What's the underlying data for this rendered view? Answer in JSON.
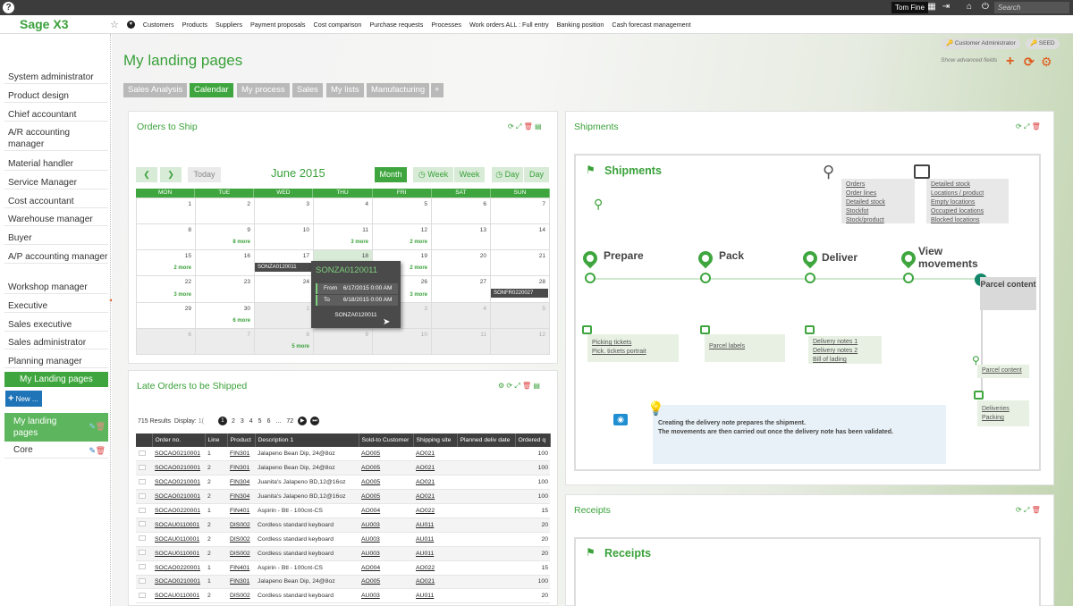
{
  "topbar": {
    "help": "?",
    "user": "Tom Fine",
    "search_placeholder": "Search"
  },
  "brand": "Sage X3",
  "menu": [
    "Customers",
    "Products",
    "Suppliers",
    "Payment proposals",
    "Cost comparison",
    "Purchase requests",
    "Processes",
    "Work orders ALL : Full entry",
    "Banking position",
    "Cash forecast management"
  ],
  "sidebar": {
    "items": [
      "System administrator",
      "Product design",
      "Chief accountant",
      "A/R accounting manager",
      "Material handler",
      "Service Manager",
      "Cost accountant",
      "Warehouse manager",
      "Buyer",
      "A/P accounting manager",
      "Workshop manager",
      "Executive",
      "Sales executive",
      "Sales administrator",
      "Planning manager"
    ],
    "section": "My Landing pages",
    "new_button": "New ...",
    "pages": [
      "My landing pages",
      "Core"
    ]
  },
  "header": {
    "title": "My landing pages",
    "role": "Customer Administrator",
    "seed": "SEED",
    "advanced": "Show advanced fields"
  },
  "tabs": [
    "Sales Analysis",
    "Calendar",
    "My process",
    "Sales",
    "My lists",
    "Manufacturing",
    "+"
  ],
  "orders_to_ship": {
    "title": "Orders to Ship",
    "nav": {
      "today": "Today",
      "month_title": "June 2015",
      "month": "Month",
      "week1": "Week",
      "week2": "Week",
      "day1": "Day",
      "day2": "Day"
    },
    "weekdays": [
      "MON",
      "TUE",
      "WED",
      "THU",
      "FRI",
      "SAT",
      "SUN"
    ],
    "weeks": [
      [
        {
          "d": "1"
        },
        {
          "d": "2"
        },
        {
          "d": "3"
        },
        {
          "d": "4"
        },
        {
          "d": "5"
        },
        {
          "d": "6"
        },
        {
          "d": "7"
        }
      ],
      [
        {
          "d": "8"
        },
        {
          "d": "9",
          "more": "8 more"
        },
        {
          "d": "10"
        },
        {
          "d": "11",
          "more": "3 more"
        },
        {
          "d": "12",
          "more": "2 more"
        },
        {
          "d": "13"
        },
        {
          "d": "14"
        }
      ],
      [
        {
          "d": "15",
          "more": "2 more"
        },
        {
          "d": "16"
        },
        {
          "d": "17",
          "ev": "SONZA0120011"
        },
        {
          "d": "18",
          "today": true
        },
        {
          "d": "19",
          "more": "2 more"
        },
        {
          "d": "20"
        },
        {
          "d": "21"
        }
      ],
      [
        {
          "d": "22",
          "more": "3 more"
        },
        {
          "d": "23"
        },
        {
          "d": "24"
        },
        {
          "d": "25"
        },
        {
          "d": "26",
          "more": "3 more"
        },
        {
          "d": "27"
        },
        {
          "d": "28",
          "ev": "SONFR0220027"
        }
      ],
      [
        {
          "d": "29"
        },
        {
          "d": "30",
          "more": "6 more"
        },
        {
          "d": "1",
          "grey": true
        },
        {
          "d": "2",
          "grey": true
        },
        {
          "d": "3",
          "grey": true
        },
        {
          "d": "4",
          "grey": true
        },
        {
          "d": "5",
          "grey": true
        }
      ],
      [
        {
          "d": "6",
          "grey": true
        },
        {
          "d": "7",
          "grey": true
        },
        {
          "d": "8",
          "grey": true,
          "more": "5 more"
        },
        {
          "d": "9",
          "grey": true
        },
        {
          "d": "10",
          "grey": true
        },
        {
          "d": "11",
          "grey": true
        },
        {
          "d": "12",
          "grey": true
        }
      ]
    ],
    "popup": {
      "title": "SONZA0120011",
      "from_label": "From",
      "from": "6/17/2015 0:00 AM",
      "to_label": "To",
      "to": "6/18/2015 0:00 AM",
      "id": "SONZA0120011"
    }
  },
  "late_orders": {
    "title": "Late Orders to be Shipped",
    "results": "715 Results",
    "display_label": "Display:",
    "display_value": "1(",
    "pages": [
      "1",
      "2",
      "3",
      "4",
      "5",
      "6",
      "...",
      "72"
    ],
    "columns": [
      "",
      "Order no.",
      "Line",
      "Product",
      "Description 1",
      "Sold-to Customer",
      "Shipping site",
      "Planned deliv date",
      "Ordered q"
    ],
    "rows": [
      [
        "SOCAO0210001",
        "1",
        "FIN301",
        "Jalapeno Bean Dip, 24@8oz",
        "AO005",
        "AO021",
        "",
        "100"
      ],
      [
        "SOCAO0210001",
        "2",
        "FIN301",
        "Jalapeno Bean Dip, 24@8oz",
        "AO005",
        "AO021",
        "",
        "100"
      ],
      [
        "SOCAO0210001",
        "2",
        "FIN304",
        "Juanita's Jalapeno BD,12@16oz",
        "AO005",
        "AO021",
        "",
        "100"
      ],
      [
        "SOCAO0210001",
        "2",
        "FIN304",
        "Juanita's Jalapeno BD,12@16oz",
        "AO005",
        "AO021",
        "",
        "100"
      ],
      [
        "SOCAO0220001",
        "1",
        "FIN401",
        "Aspirin - Btl - 100cnt-CS",
        "AO004",
        "AO022",
        "",
        "15"
      ],
      [
        "SOCAU0110001",
        "2",
        "DIS002",
        "Cordless standard keyboard",
        "AU003",
        "AU011",
        "",
        "20"
      ],
      [
        "SOCAU0110001",
        "2",
        "DIS002",
        "Cordless standard keyboard",
        "AU003",
        "AU011",
        "",
        "20"
      ],
      [
        "SOCAU0110001",
        "2",
        "DIS002",
        "Cordless standard keyboard",
        "AU003",
        "AU011",
        "",
        "20"
      ],
      [
        "SOCAO0220001",
        "1",
        "FIN401",
        "Aspirin - Btl - 100cnt-CS",
        "AO004",
        "AO022",
        "",
        "15"
      ],
      [
        "SOCAO0210001",
        "1",
        "FIN301",
        "Jalapeno Bean Dip, 24@8oz",
        "AO005",
        "AO021",
        "",
        "100"
      ],
      [
        "SOCAU0110001",
        "2",
        "DIS002",
        "Cordless standard keyboard",
        "AU003",
        "AU011",
        "",
        "20"
      ]
    ]
  },
  "shipments": {
    "panel_title": "Shipments",
    "title": "Shipments",
    "search_links": [
      "Orders",
      "Order lines",
      "Detailed stock",
      "Stockfot",
      "Stock/product"
    ],
    "print_links": [
      "Detailed stock",
      "Locations / product",
      "Empty locations",
      "Occupied locations",
      "Blocked locations"
    ],
    "steps": [
      "Prepare",
      "Pack",
      "Deliver",
      "View movements"
    ],
    "parcel": "Parcel content",
    "step_links": [
      [
        "Picking tickets",
        "Pick. tickets portrait"
      ],
      [
        "Parcel labels"
      ],
      [
        "Delivery notes 1",
        "Delivery notes 2",
        "Bill of lading"
      ]
    ],
    "parcel_link": "Parcel content",
    "deliveries_links": [
      "Deliveries",
      "Packing"
    ],
    "info": [
      "Creating the delivery note prepares the shipment.",
      "The movements are then carried out once the delivery note has been validated."
    ]
  },
  "receipts": {
    "panel_title": "Receipts",
    "title": "Receipts"
  },
  "colors": {
    "accent": "#3fa63f",
    "topbar": "#3c3c3c",
    "orange": "#e05a1a"
  }
}
